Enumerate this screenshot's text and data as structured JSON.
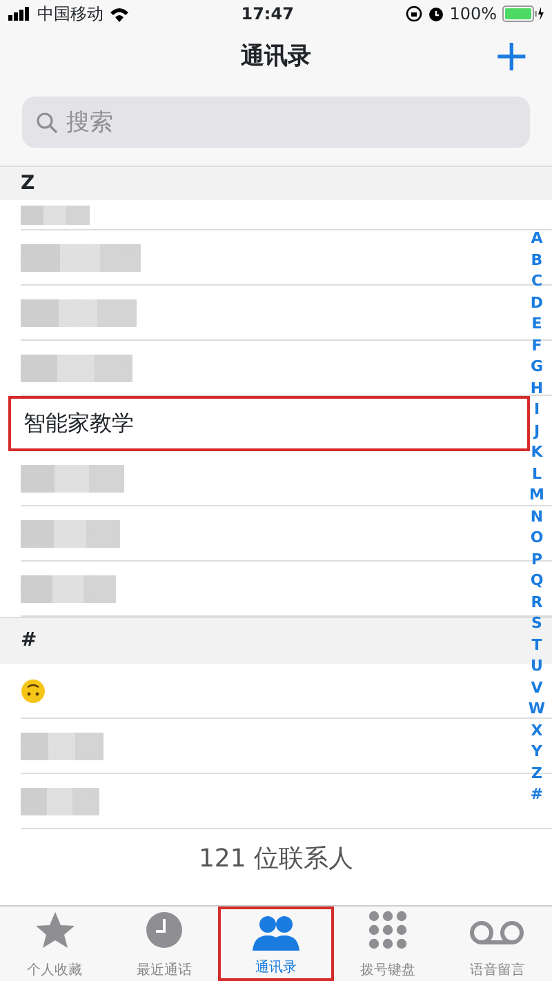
{
  "status_bar": {
    "carrier": "中国移动",
    "time": "17:47",
    "battery": "100%"
  },
  "nav": {
    "title": "通讯录",
    "add": "+"
  },
  "search": {
    "placeholder": "搜索"
  },
  "sections": [
    {
      "letter": "Z",
      "rows": [
        {
          "kind": "blurred",
          "highlighted": false
        },
        {
          "kind": "blurred",
          "highlighted": false
        },
        {
          "kind": "blurred",
          "highlighted": false
        },
        {
          "kind": "blurred",
          "highlighted": false
        },
        {
          "kind": "name",
          "name": "智能家教学",
          "highlighted": true
        },
        {
          "kind": "blurred",
          "highlighted": false
        },
        {
          "kind": "blurred",
          "highlighted": false
        },
        {
          "kind": "blurred",
          "highlighted": false
        }
      ]
    },
    {
      "letter": "#",
      "rows": [
        {
          "kind": "emoji",
          "highlighted": false
        },
        {
          "kind": "blurred",
          "highlighted": false
        },
        {
          "kind": "blurred",
          "highlighted": false
        }
      ]
    }
  ],
  "index": [
    "A",
    "B",
    "C",
    "D",
    "E",
    "F",
    "G",
    "H",
    "I",
    "J",
    "K",
    "L",
    "M",
    "N",
    "O",
    "P",
    "Q",
    "R",
    "S",
    "T",
    "U",
    "V",
    "W",
    "X",
    "Y",
    "Z",
    "#"
  ],
  "footer": "121 位联系人",
  "tabs": [
    {
      "label": "个人收藏",
      "selected": false,
      "highlighted": false
    },
    {
      "label": "最近通话",
      "selected": false,
      "highlighted": false
    },
    {
      "label": "通讯录",
      "selected": true,
      "highlighted": true
    },
    {
      "label": "拨号键盘",
      "selected": false,
      "highlighted": false
    },
    {
      "label": "语音留言",
      "selected": false,
      "highlighted": false
    }
  ]
}
